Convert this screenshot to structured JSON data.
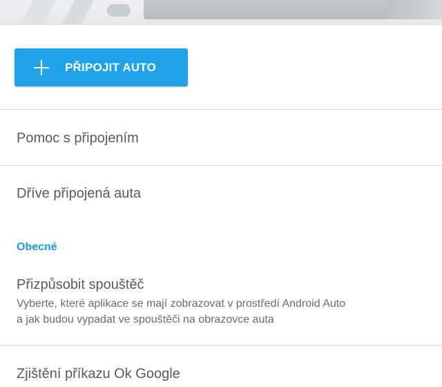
{
  "connect_button": {
    "label": "PŘIPOJIT AUTO",
    "icon": "plus-icon",
    "color": "#1ea2e8"
  },
  "list": {
    "connection_help": "Pomoc s připojením",
    "previously_connected": "Dříve připojená auta"
  },
  "general": {
    "header": "Obecné",
    "header_color": "#1a9be0",
    "customize_launcher": {
      "title": "Přizpůsobit spouštěč",
      "subtitle_line1": "Vyberte, které aplikace se mají zobrazovat v prostředí Android Auto",
      "subtitle_line2": "a jak budou vypadat ve spouštěči na obrazovce auta"
    },
    "ok_google": {
      "title": "Zjištění příkazu Ok Google"
    }
  }
}
